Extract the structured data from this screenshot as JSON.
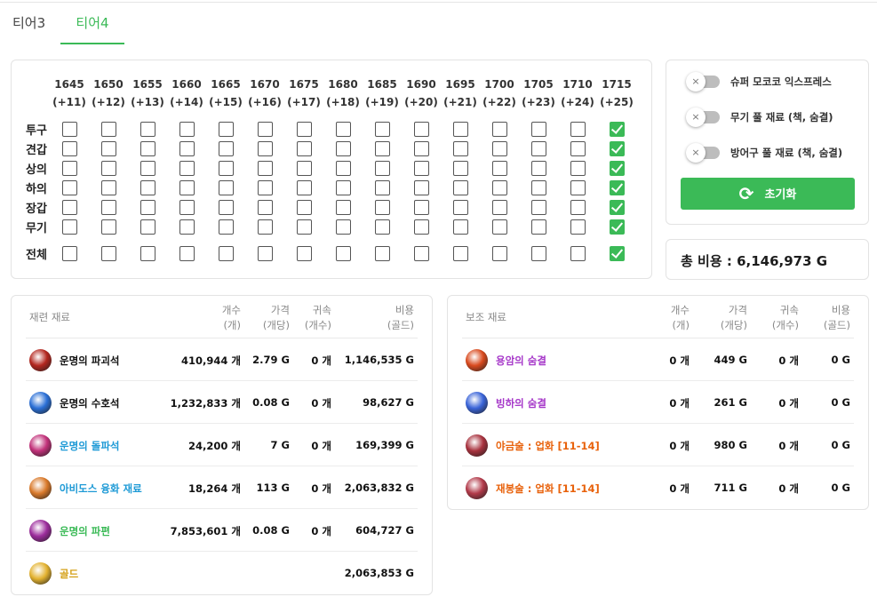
{
  "tabs": [
    "티어3",
    "티어4"
  ],
  "grid": {
    "columns": [
      {
        "level": "1645",
        "plus": "(+11)"
      },
      {
        "level": "1650",
        "plus": "(+12)"
      },
      {
        "level": "1655",
        "plus": "(+13)"
      },
      {
        "level": "1660",
        "plus": "(+14)"
      },
      {
        "level": "1665",
        "plus": "(+15)"
      },
      {
        "level": "1670",
        "plus": "(+16)"
      },
      {
        "level": "1675",
        "plus": "(+17)"
      },
      {
        "level": "1680",
        "plus": "(+18)"
      },
      {
        "level": "1685",
        "plus": "(+19)"
      },
      {
        "level": "1690",
        "plus": "(+20)"
      },
      {
        "level": "1695",
        "plus": "(+21)"
      },
      {
        "level": "1700",
        "plus": "(+22)"
      },
      {
        "level": "1705",
        "plus": "(+23)"
      },
      {
        "level": "1710",
        "plus": "(+24)"
      },
      {
        "level": "1715",
        "plus": "(+25)"
      }
    ],
    "rows": [
      "투구",
      "견갑",
      "상의",
      "하의",
      "장갑",
      "무기"
    ],
    "all_label": "전체",
    "checked_column": 14
  },
  "options": {
    "items": [
      "슈퍼 모코코 익스프레스",
      "무기 풀 재료 (책, 숨결)",
      "방어구 풀 재료 (책, 숨결)"
    ],
    "toggle_off_glyph": "×",
    "reset_label": "초기화",
    "accent_color": "#3bba57"
  },
  "total": {
    "label": "총 비용 : 6,146,973 G"
  },
  "materials": {
    "headers": {
      "name": "재련 재료",
      "count": [
        "개수",
        "(개)"
      ],
      "price": [
        "가격",
        "(개당)"
      ],
      "bound": [
        "귀속",
        "(개수)"
      ],
      "cost": [
        "비용",
        "(골드)"
      ]
    },
    "rows": [
      {
        "name": "운명의 파괴석",
        "count": "410,944 개",
        "price": "2.79 G",
        "bound": "0 개",
        "cost": "1,146,535 G",
        "color": "#111111",
        "icon": "destruction-stone-icon",
        "icon_color": "#b3261e"
      },
      {
        "name": "운명의 수호석",
        "count": "1,232,833 개",
        "price": "0.08 G",
        "bound": "0 개",
        "cost": "98,627 G",
        "color": "#111111",
        "icon": "guardian-stone-icon",
        "icon_color": "#2a6fd6"
      },
      {
        "name": "운명의 돌파석",
        "count": "24,200 개",
        "price": "7 G",
        "bound": "0 개",
        "cost": "169,399 G",
        "color": "#1e9ad6",
        "icon": "leapstone-icon",
        "icon_color": "#c2317a"
      },
      {
        "name": "아비도스 융화 재료",
        "count": "18,264 개",
        "price": "113 G",
        "bound": "0 개",
        "cost": "2,063,832 G",
        "color": "#1e9ad6",
        "icon": "fusion-material-icon",
        "icon_color": "#d9792a"
      },
      {
        "name": "운명의 파편",
        "count": "7,853,601 개",
        "price": "0.08 G",
        "bound": "0 개",
        "cost": "604,727 G",
        "color": "#3bba57",
        "icon": "shard-icon",
        "icon_color": "#9c2c9c"
      },
      {
        "name": "골드",
        "count": "",
        "price": "",
        "bound": "",
        "cost": "2,063,853 G",
        "color": "#d4a017",
        "icon": "gold-icon",
        "icon_color": "#e3b230"
      }
    ]
  },
  "auxiliary": {
    "headers": {
      "name": "보조 재료",
      "count": [
        "개수",
        "(개)"
      ],
      "price": [
        "가격",
        "(개당)"
      ],
      "bound": [
        "귀속",
        "(개수)"
      ],
      "cost": [
        "비용",
        "(골드)"
      ]
    },
    "rows": [
      {
        "name": "용암의 숨결",
        "count": "0 개",
        "price": "449 G",
        "bound": "0 개",
        "cost": "0 G",
        "color": "#a638c9",
        "icon": "lava-breath-icon",
        "icon_color": "#d94a1e"
      },
      {
        "name": "빙하의 숨결",
        "count": "0 개",
        "price": "261 G",
        "bound": "0 개",
        "cost": "0 G",
        "color": "#a638c9",
        "icon": "glacier-breath-icon",
        "icon_color": "#3a64d8"
      },
      {
        "name": "야금술 : 업화 [11-14]",
        "count": "0 개",
        "price": "980 G",
        "bound": "0 개",
        "cost": "0 G",
        "color": "#e8620c",
        "icon": "metallurgy-book-icon",
        "icon_color": "#a8323e"
      },
      {
        "name": "재봉술 : 업화 [11-14]",
        "count": "0 개",
        "price": "711 G",
        "bound": "0 개",
        "cost": "0 G",
        "color": "#e8620c",
        "icon": "tailoring-book-icon",
        "icon_color": "#b23a4a"
      }
    ]
  }
}
